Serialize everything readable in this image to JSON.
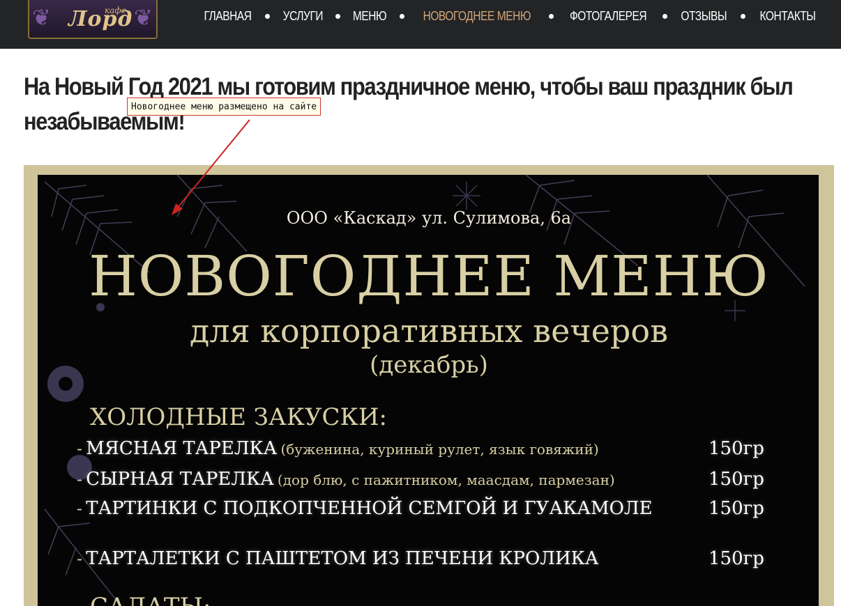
{
  "header": {
    "logo": {
      "small": "кафе",
      "big": "Лорд"
    },
    "nav": [
      {
        "label": "ГЛАВНАЯ",
        "active": false
      },
      {
        "label": "УСЛУГИ",
        "active": false
      },
      {
        "label": "МЕНЮ",
        "active": false
      },
      {
        "label": "НОВОГОДНЕЕ МЕНЮ",
        "active": true
      },
      {
        "label": "ФОТОГАЛЕРЕЯ",
        "active": false
      },
      {
        "label": "ОТЗЫВЫ",
        "active": false
      },
      {
        "label": "КОНТАКТЫ",
        "active": false
      }
    ],
    "active_color": "#d2a67a"
  },
  "main": {
    "headline_line1": "На Новый Год 2021 мы готовим праздничное меню, чтобы ваш праздник был",
    "headline_line2": "незабываемым!"
  },
  "annotation": {
    "text": "Новогоднее меню размещено на сайте",
    "border_color": "#cc3333",
    "arrow_color": "#cc2222"
  },
  "poster": {
    "address": "ООО «Каскад» ул. Сулимова, 6а",
    "title": "НОВОГОДНЕЕ МЕНЮ",
    "subtitle": "для корпоративных вечеров",
    "month": "(декабрь)",
    "section_cold": "ХОЛОДНЫЕ ЗАКУСКИ:",
    "items": [
      {
        "dash": "-",
        "name": "МЯСНАЯ ТАРЕЛКА",
        "desc": "(буженина, куриный рулет, язык говяжий)",
        "weight": "150гр"
      },
      {
        "dash": "-",
        "name": "СЫРНАЯ ТАРЕЛКА",
        "desc": "(дор блю, с пажитником, маасдам, пармезан)",
        "weight": "150гр"
      },
      {
        "dash": "-",
        "name": "ТАРТИНКИ С ПОДКОПЧЕННОЙ СЕМГОЙ И ГУАКАМОЛЕ",
        "desc": "",
        "weight": "150гр"
      },
      {
        "dash": "-",
        "name": "ТАРТАЛЕТКИ С ПАШТЕТОМ ИЗ ПЕЧЕНИ КРОЛИКА",
        "desc": "",
        "weight": "150гр"
      }
    ],
    "section_salads": "САЛАТЫ:",
    "colors": {
      "frame": "#cfc49a",
      "background": "#050505",
      "gold_text": "#d8cfa4"
    }
  }
}
